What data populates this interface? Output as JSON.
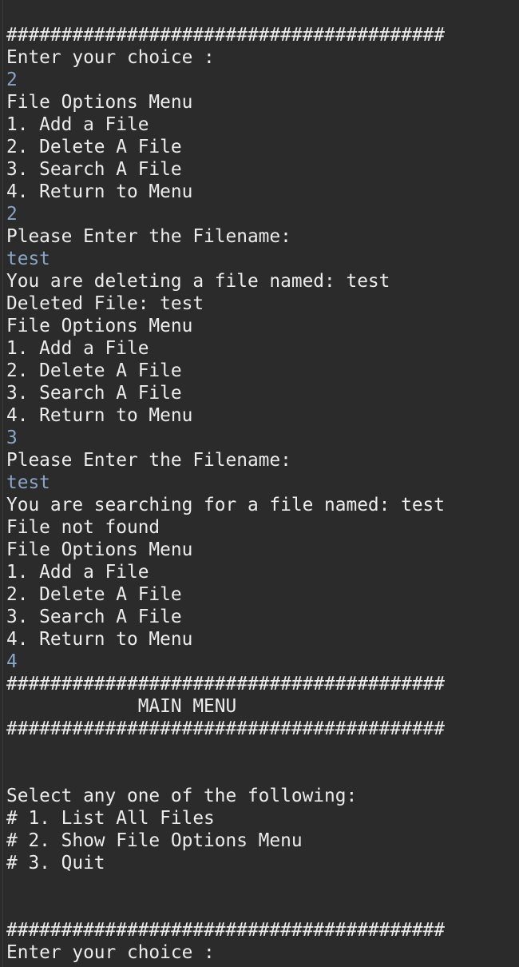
{
  "console": {
    "lines": [
      {
        "text": "########################################",
        "kind": "output"
      },
      {
        "text": "Enter your choice :",
        "kind": "output"
      },
      {
        "text": "2",
        "kind": "input"
      },
      {
        "text": "File Options Menu",
        "kind": "output"
      },
      {
        "text": "1. Add a File",
        "kind": "output"
      },
      {
        "text": "2. Delete A File",
        "kind": "output"
      },
      {
        "text": "3. Search A File",
        "kind": "output"
      },
      {
        "text": "4. Return to Menu",
        "kind": "output"
      },
      {
        "text": "2",
        "kind": "input"
      },
      {
        "text": "Please Enter the Filename:",
        "kind": "output"
      },
      {
        "text": "test",
        "kind": "input"
      },
      {
        "text": "You are deleting a file named: test",
        "kind": "output"
      },
      {
        "text": "Deleted File: test",
        "kind": "output"
      },
      {
        "text": "File Options Menu",
        "kind": "output"
      },
      {
        "text": "1. Add a File",
        "kind": "output"
      },
      {
        "text": "2. Delete A File",
        "kind": "output"
      },
      {
        "text": "3. Search A File",
        "kind": "output"
      },
      {
        "text": "4. Return to Menu",
        "kind": "output"
      },
      {
        "text": "3",
        "kind": "input"
      },
      {
        "text": "Please Enter the Filename:",
        "kind": "output"
      },
      {
        "text": "test",
        "kind": "input"
      },
      {
        "text": "You are searching for a file named: test",
        "kind": "output"
      },
      {
        "text": "File not found",
        "kind": "output"
      },
      {
        "text": "File Options Menu",
        "kind": "output"
      },
      {
        "text": "1. Add a File",
        "kind": "output"
      },
      {
        "text": "2. Delete A File",
        "kind": "output"
      },
      {
        "text": "3. Search A File",
        "kind": "output"
      },
      {
        "text": "4. Return to Menu",
        "kind": "output"
      },
      {
        "text": "4",
        "kind": "input"
      },
      {
        "text": "########################################",
        "kind": "output"
      },
      {
        "text": "            MAIN MENU",
        "kind": "output"
      },
      {
        "text": "########################################",
        "kind": "output"
      },
      {
        "text": "",
        "kind": "blank"
      },
      {
        "text": "",
        "kind": "blank"
      },
      {
        "text": "Select any one of the following:",
        "kind": "output"
      },
      {
        "text": "# 1. List All Files",
        "kind": "output"
      },
      {
        "text": "# 2. Show File Options Menu",
        "kind": "output"
      },
      {
        "text": "# 3. Quit",
        "kind": "output"
      },
      {
        "text": "",
        "kind": "blank"
      },
      {
        "text": "",
        "kind": "blank"
      },
      {
        "text": "########################################",
        "kind": "output"
      },
      {
        "text": "Enter your choice :",
        "kind": "output"
      }
    ]
  }
}
